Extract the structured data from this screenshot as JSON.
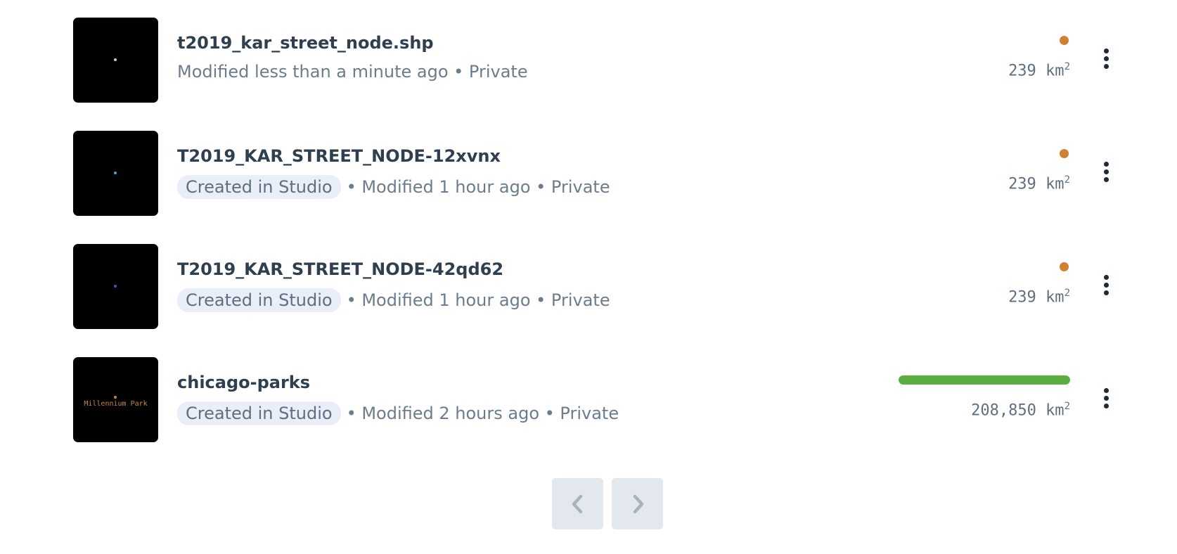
{
  "datasets": [
    {
      "name": "t2019_kar_street_node.shp",
      "tag": "",
      "meta": "Modified less than a minute ago • Private",
      "status": "processing",
      "status_color": "#d08033",
      "area_value": "239",
      "area_unit": "km",
      "area_exp": "2",
      "thumb_dot_color": "#b7e08a",
      "thumb_label": ""
    },
    {
      "name": "T2019_KAR_STREET_NODE-12xvnx",
      "tag": "Created in Studio",
      "meta": "• Modified 1 hour ago • Private",
      "status": "processing",
      "status_color": "#d08033",
      "area_value": "239",
      "area_unit": "km",
      "area_exp": "2",
      "thumb_dot_color": "#3fa7d6",
      "thumb_label": ""
    },
    {
      "name": "T2019_KAR_STREET_NODE-42qd62",
      "tag": "Created in Studio",
      "meta": "• Modified 1 hour ago • Private",
      "status": "processing",
      "status_color": "#d08033",
      "area_value": "239",
      "area_unit": "km",
      "area_exp": "2",
      "thumb_dot_color": "#5a4fa8",
      "thumb_label": ""
    },
    {
      "name": "chicago-parks",
      "tag": "Created in Studio",
      "meta": "• Modified 2 hours ago • Private",
      "status": "complete",
      "status_color": "#5aae3f",
      "progress": 1.0,
      "area_value": "208,850",
      "area_unit": "km",
      "area_exp": "2",
      "thumb_dot_color": "#d08033",
      "thumb_label": "Millennium Park"
    }
  ],
  "pagination": {
    "prev_icon": "chevron-left-icon",
    "next_icon": "chevron-right-icon"
  }
}
